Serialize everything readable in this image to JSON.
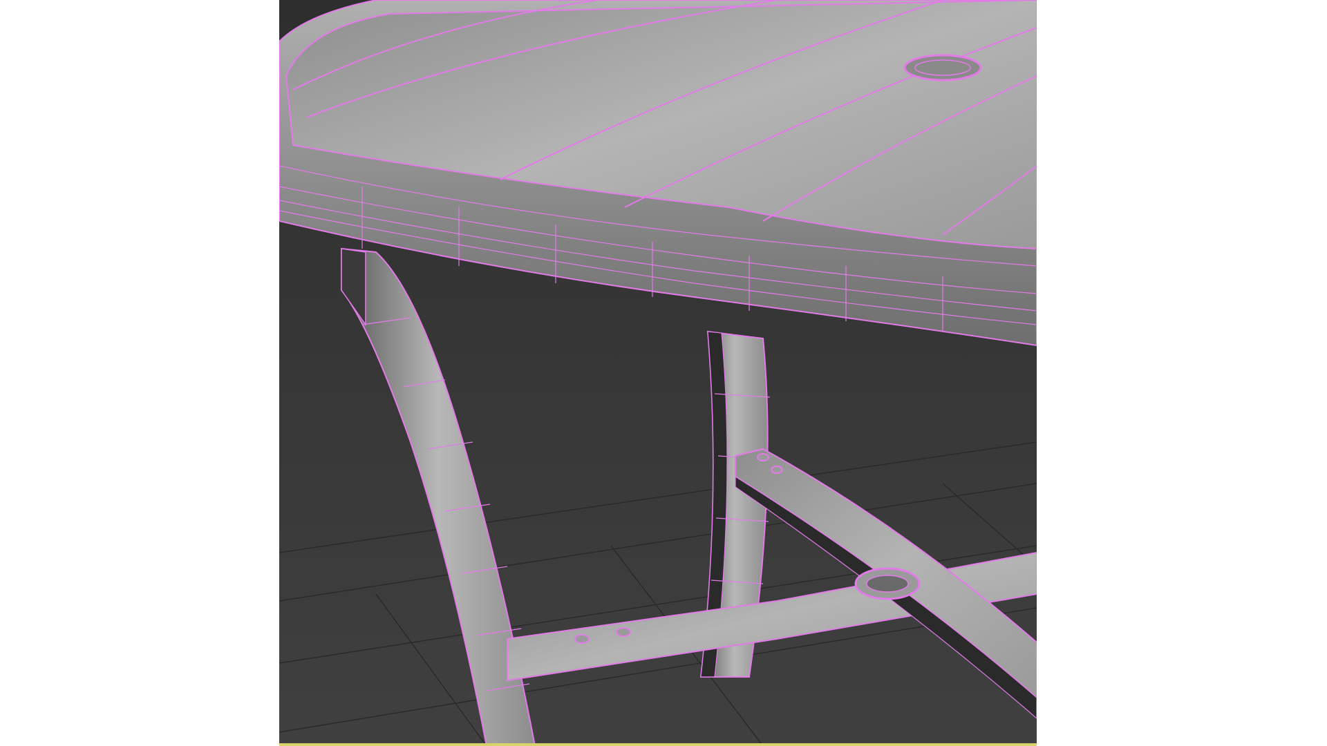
{
  "viewport": {
    "background_color": "#3c3c3c",
    "grid_color": "#2a2a2a",
    "wireframe_color": "#e27be8",
    "bottom_border_color": "#d8d46a"
  }
}
